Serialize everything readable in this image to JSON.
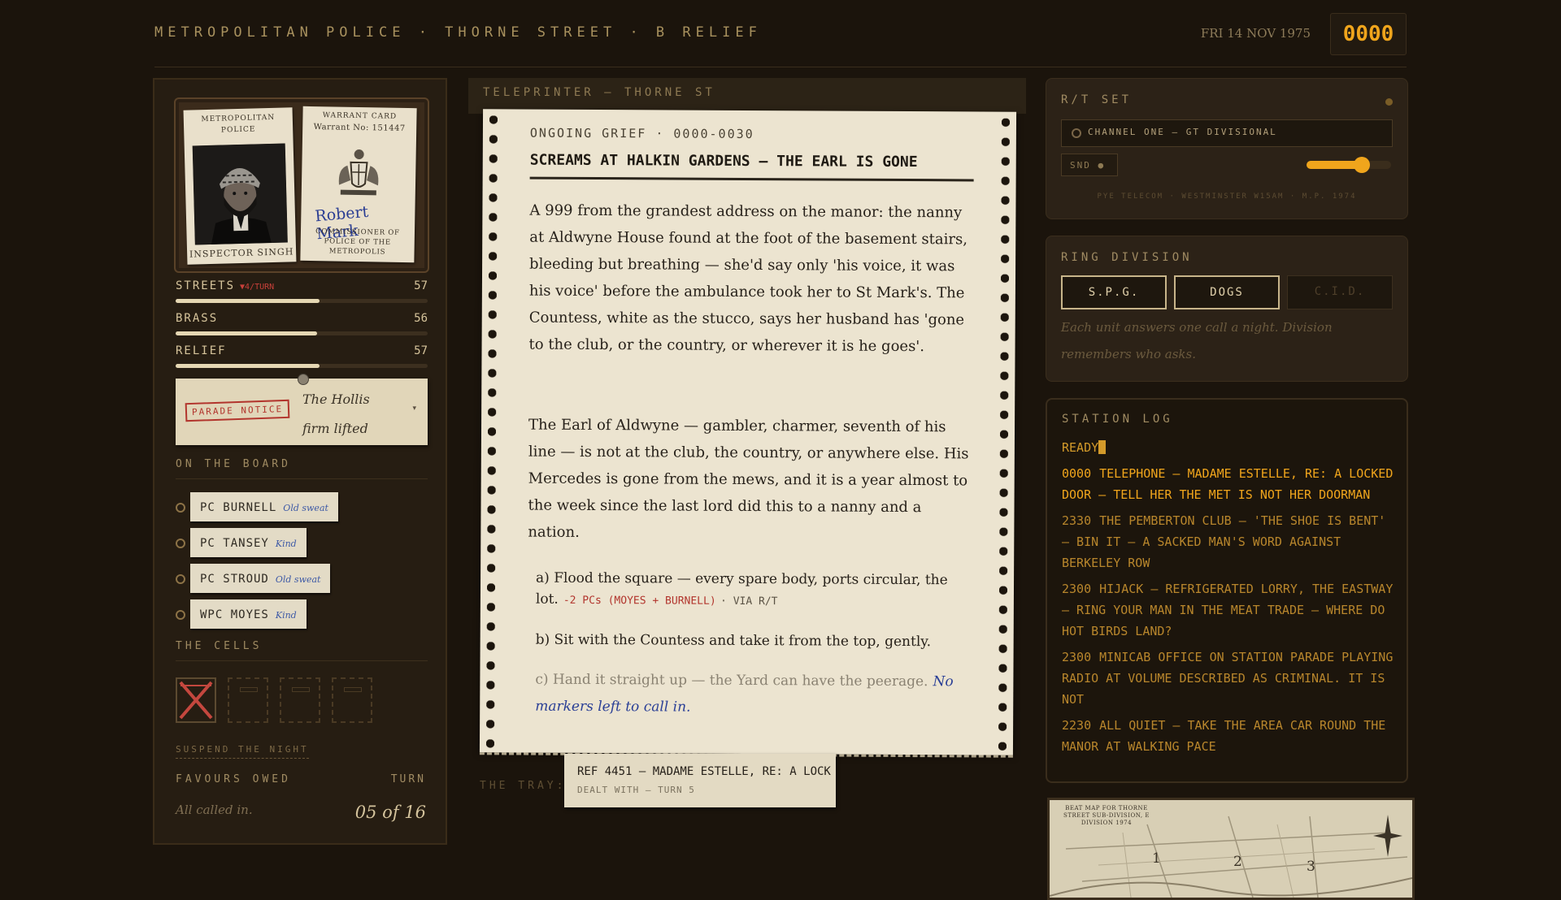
{
  "header": {
    "title": "METROPOLITAN POLICE · THORNE STREET · B RELIEF",
    "date": "FRI 14 NOV 1975",
    "clock": "0000"
  },
  "id_card": {
    "left_org": "METROPOLITAN POLICE",
    "officer_name": "INSPECTOR SINGH",
    "warrant_title": "WARRANT CARD",
    "warrant_no": "Warrant No: 151447",
    "signature": "Robert Mark",
    "commissioner": "COMMISSIONER OF POLICE OF THE METROPOLIS"
  },
  "stats": [
    {
      "label": "STREETS",
      "trend": "▼4/TURN",
      "value": 57
    },
    {
      "label": "BRASS",
      "trend": "",
      "value": 56
    },
    {
      "label": "RELIEF",
      "trend": "",
      "value": 57
    }
  ],
  "parade_notice": {
    "stamp": "PARADE NOTICE",
    "text": "The Hollis firm lifted",
    "caret": "▾"
  },
  "board": {
    "label": "ON THE BOARD",
    "officers": [
      {
        "name": "PC BURNELL",
        "trait": "Old sweat"
      },
      {
        "name": "PC TANSEY",
        "trait": "Kind"
      },
      {
        "name": "PC STROUD",
        "trait": "Old sweat"
      },
      {
        "name": "WPC MOYES",
        "trait": "Kind"
      }
    ]
  },
  "cells": {
    "label": "THE CELLS",
    "slots": [
      "crossed",
      "empty",
      "empty",
      "empty"
    ]
  },
  "footer_left": {
    "suspend": "SUSPEND THE NIGHT",
    "favours_label": "FAVOURS OWED",
    "turn_label": "TURN",
    "favours_value": "All called in.",
    "turn_value": "05 of 16"
  },
  "teleprinter": {
    "title": "TELEPRINTER — THORNE ST",
    "ref": "ONGOING GRIEF · 0000-0030",
    "headline": "SCREAMS AT HALKIN GARDENS — THE EARL IS GONE",
    "para1": "A 999 from the grandest address on the manor: the nanny at Aldwyne House found at the foot of the basement stairs, bleeding but breathing — she'd say only 'his voice, it was his voice' before the ambulance took her to St Mark's. The Countess, white as the stucco, says her husband has 'gone to the club, or the country, or wherever it is he goes'.",
    "para2": "The Earl of Aldwyne — gambler, charmer, seventh of his line — is not at the club, the country, or anywhere else. His Mercedes is gone from the mews, and it is a year almost to the week since the last lord did this to a nanny and a nation.",
    "option_a": "a) Flood the square — every spare body, ports circular, the lot.",
    "option_a_cost": "-2 PCs (MOYES + BURNELL)",
    "option_a_via": "· VIA R/T",
    "option_b": "b) Sit with the Countess and take it from the top, gently.",
    "option_c": "c) Hand it straight up — the Yard can have the peerage.",
    "option_c_note": "No markers left to call in."
  },
  "tray": {
    "label": "THE TRAY:",
    "ref": "REF 4451 — MADAME ESTELLE, RE: A LOCK",
    "status": "DEALT WITH — TURN 5"
  },
  "rt_set": {
    "title": "R/T SET",
    "channel": "CHANNEL ONE — GT DIVISIONAL",
    "snd": "SND ●",
    "volume": 0.65,
    "maker": "PYE TELECOM · WESTMINSTER W15AM · M.P. 1974"
  },
  "ring_division": {
    "title": "RING DIVISION",
    "buttons": [
      "S.P.G.",
      "DOGS",
      "C.I.D."
    ],
    "note": "Each unit answers one call a night. Division remembers who asks."
  },
  "station_log": {
    "title": "STATION LOG",
    "ready": "READY",
    "entries": [
      {
        "time": "0000",
        "text": "TELEPHONE — MADAME ESTELLE, RE: A LOCKED DOOR — TELL HER THE MET IS NOT HER DOORMAN",
        "current": true
      },
      {
        "time": "2330",
        "text": "THE PEMBERTON CLUB — 'THE SHOE IS BENT' — BIN IT — A SACKED MAN'S WORD AGAINST BERKELEY ROW",
        "current": false
      },
      {
        "time": "2300",
        "text": "HIJACK — REFRIGERATED LORRY, THE EASTWAY — RING YOUR MAN IN THE MEAT TRADE — WHERE DO HOT BIRDS LAND?",
        "current": false
      },
      {
        "time": "2300",
        "text": "MINICAB OFFICE ON STATION PARADE PLAYING RADIO AT VOLUME DESCRIBED AS CRIMINAL. IT IS NOT",
        "current": false
      },
      {
        "time": "2230",
        "text": "ALL QUIET — TAKE THE AREA CAR ROUND THE MANOR AT WALKING PACE",
        "current": false
      }
    ]
  },
  "map": {
    "caption": "BEAT MAP FOR THORNE STREET SUB-DIVISION, E DIVISION 1974",
    "beats": [
      "1",
      "2",
      "3"
    ]
  }
}
